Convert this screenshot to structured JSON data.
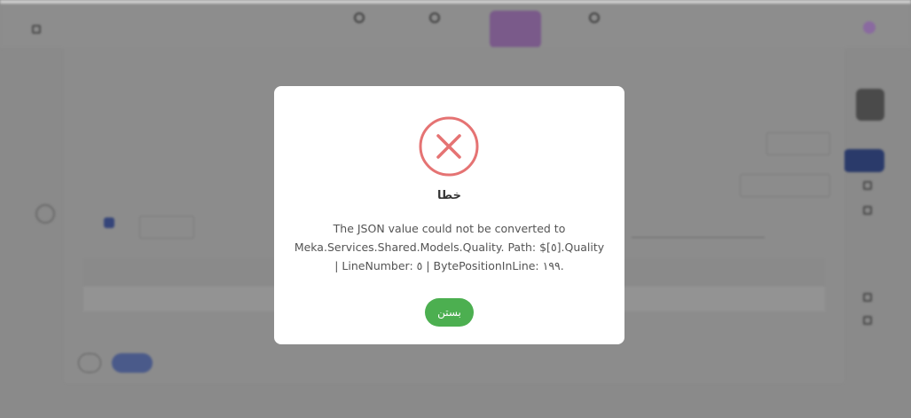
{
  "colors": {
    "error_accent": "#e57373",
    "close_button": "#4caf50"
  },
  "error_dialog": {
    "icon": "error-x-circle-icon",
    "title": "خطا",
    "message_lines": [
      "The JSON value could not be converted to",
      "Meka.Services.Shared.Models.Quality. Path: $[٥].Quality",
      "| LineNumber: ٥ | BytePositionInLine: ١٩٩."
    ],
    "close_label": "بستن"
  }
}
